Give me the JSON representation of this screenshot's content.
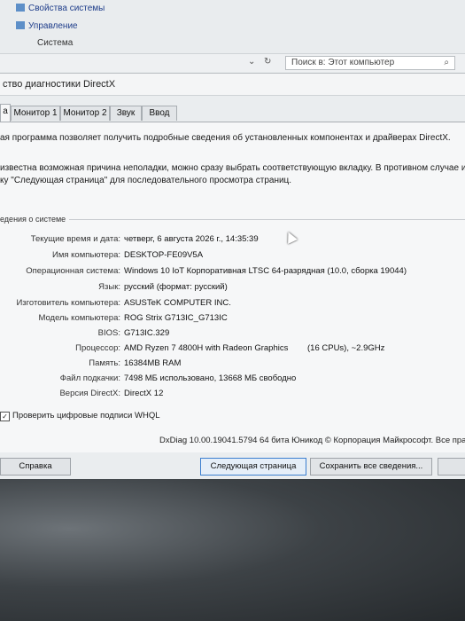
{
  "explorer": {
    "links": [
      "Свойства системы",
      "Управление"
    ],
    "section": "Система",
    "nav_icons": {
      "down": "chevron-down-icon",
      "refresh": "refresh-icon"
    },
    "search_placeholder": "Поиск в: Этот компьютер",
    "search_icon": "search-icon"
  },
  "dialog": {
    "title": "ство диагностики DirectX",
    "tabs": [
      {
        "label": "а",
        "active": true
      },
      {
        "label": "Монитор 1"
      },
      {
        "label": "Монитор 2"
      },
      {
        "label": "Звук"
      },
      {
        "label": "Ввод"
      }
    ],
    "intro1": "ая программа позволяет получить подробные сведения об установленных компонентах и драйверах DirectX.",
    "intro2": "известна возможная причина неполадки, можно сразу выбрать соответствующую вкладку. В противном случае и",
    "intro3": "ку \"Следующая страница\" для последовательного просмотра страниц.",
    "group_title": "едения о системе",
    "info": [
      {
        "label": "Текущие время и дата:",
        "value": "четверг, 6 августа 2026 г., 14:35:39"
      },
      {
        "label": "Имя компьютера:",
        "value": "DESKTOP-FE09V5A"
      },
      {
        "label": "Операционная система:",
        "value": "Windows 10 IoT Корпоративная LTSC 64-разрядная (10.0, сборка 19044)"
      },
      {
        "label": "Язык:",
        "value": "русский (формат: русский)"
      },
      {
        "label": "Изготовитель компьютера:",
        "value": "ASUSTeK COMPUTER INC."
      },
      {
        "label": "Модель компьютера:",
        "value": "ROG Strix G713IC_G713IC"
      },
      {
        "label": "BIOS:",
        "value": "G713IC.329"
      },
      {
        "label": "Процессор:",
        "value": "AMD Ryzen 7 4800H with Radeon Graphics",
        "value2": "(16 CPUs), ~2.9GHz"
      },
      {
        "label": "Память:",
        "value": "16384MB RAM"
      },
      {
        "label": "Файл подкачки:",
        "value": "7498 МБ использовано, 13668 МБ свободно"
      },
      {
        "label": "Версия DirectX:",
        "value": "DirectX 12"
      }
    ],
    "whql_label": "Проверить цифровые подписи WHQL",
    "whql_checked": true,
    "version_line": "DxDiag 10.00.19041.5794 64 бита Юникод © Корпорация Майкрософт. Все пра",
    "buttons": {
      "help": "Справка",
      "next": "Следующая страница",
      "save": "Сохранить все сведения..."
    }
  }
}
